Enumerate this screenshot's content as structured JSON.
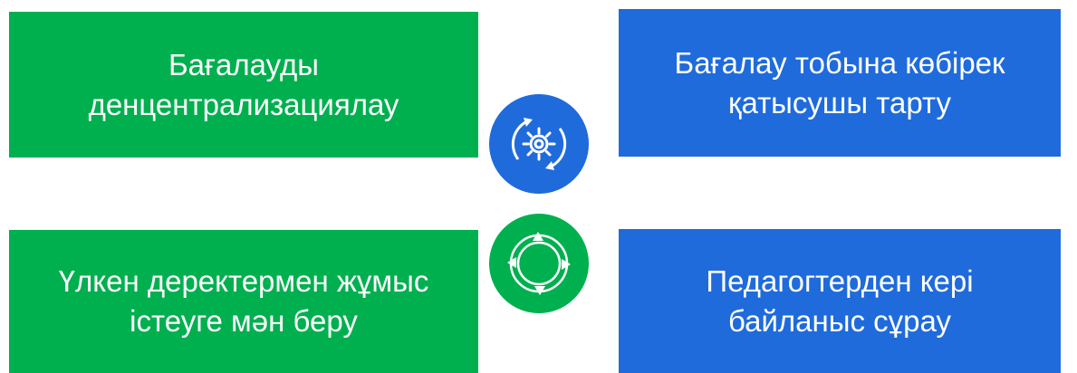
{
  "boxes": {
    "top_left": "Бағалауды\nденцентрализациялау",
    "top_right": "Бағалау тобына көбірек\nқатысушы тарту",
    "bottom_left": "Үлкен деректермен жұмыс\nістеуге мән беру",
    "bottom_right": "Педагогтерден кері\nбайланыс  сұрау"
  },
  "icons": {
    "center_top": "gear-cycle-icon",
    "center_bottom": "circular-arrows-icon"
  },
  "colors": {
    "green": "#00b04f",
    "blue": "#1f6bdc",
    "white": "#ffffff"
  }
}
